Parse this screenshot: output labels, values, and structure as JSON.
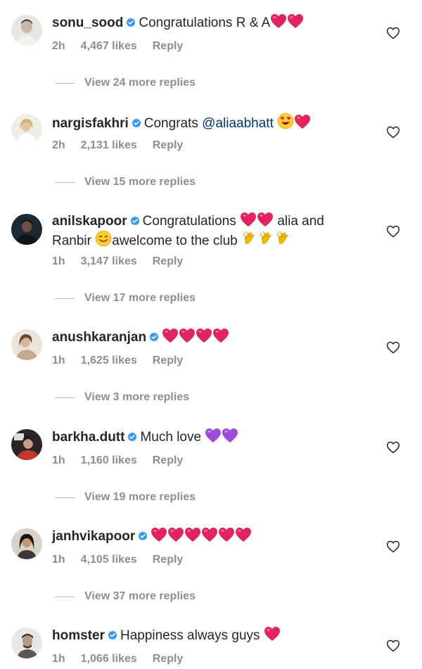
{
  "comments": [
    {
      "username": "sonu_sood",
      "text": "Congratulations R & A",
      "emojis": [
        "red-heart",
        "red-heart"
      ],
      "time": "2h",
      "likes": "4,467 likes",
      "reply": "Reply",
      "view_replies": "View 24 more replies"
    },
    {
      "username": "nargisfakhri",
      "text": "Congrats",
      "mention": "@aliaabhatt",
      "emojis": [
        "heart-eyes",
        "red-heart"
      ],
      "time": "2h",
      "likes": "2,131 likes",
      "reply": "Reply",
      "view_replies": "View 15 more replies"
    },
    {
      "username": "anilskapoor",
      "text_a": "Congratulations",
      "text_b": "alia and",
      "text_c": "Ranbir",
      "text_d": "awelcome to the club",
      "time": "1h",
      "likes": "3,147 likes",
      "reply": "Reply",
      "view_replies": "View 17 more replies"
    },
    {
      "username": "anushkaranjan",
      "text": "",
      "emojis": [
        "red-heart",
        "red-heart",
        "red-heart",
        "red-heart"
      ],
      "time": "1h",
      "likes": "1,625 likes",
      "reply": "Reply",
      "view_replies": "View 3 more replies"
    },
    {
      "username": "barkha.dutt",
      "text": "Much love",
      "emojis": [
        "purple-heart",
        "purple-heart"
      ],
      "time": "1h",
      "likes": "1,160 likes",
      "reply": "Reply",
      "view_replies": "View 19 more replies"
    },
    {
      "username": "janhvikapoor",
      "text": "",
      "emojis": [
        "red-heart",
        "red-heart",
        "red-heart",
        "red-heart",
        "red-heart",
        "red-heart"
      ],
      "time": "1h",
      "likes": "4,105 likes",
      "reply": "Reply",
      "view_replies": "View 37 more replies"
    },
    {
      "username": "homster",
      "text": "Happiness always guys",
      "emojis": [
        "red-heart"
      ],
      "time": "1h",
      "likes": "1,066 likes",
      "reply": "Reply"
    }
  ],
  "colors": {
    "text": "#262626",
    "muted": "#8e8e8e",
    "verified": "#3897f0",
    "mention": "#00376b",
    "red_heart": "#e0245e",
    "purple_heart": "#9b4dd6"
  }
}
